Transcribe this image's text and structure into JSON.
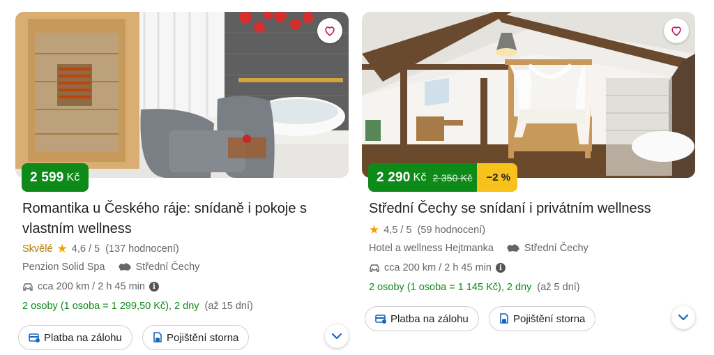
{
  "cards": [
    {
      "price": "2 599",
      "currency": "Kč",
      "title": "Romantika u Českého ráje: snídaně i pokoje s vlastním wellness",
      "rating_word": "Skvělé",
      "rating": "4,6 / 5",
      "reviews": "(137 hodnocení)",
      "hotel": "Penzion Solid Spa",
      "region": "Střední Čechy",
      "distance": "cca 200 km / 2 h 45 min",
      "offer": "2 osoby (1 osoba = 1 299,50 Kč), 2 dny",
      "availability": "(až 15 dní)",
      "pay_label": "Platba na zálohu",
      "insurance_label": "Pojištění storna"
    },
    {
      "price": "2 290",
      "currency": "Kč",
      "old_price": "2 350 Kč",
      "discount": "−2 %",
      "title": "Střední Čechy se snídaní i privátním wellness",
      "rating": "4,5 / 5",
      "reviews": "(59 hodnocení)",
      "hotel": "Hotel a wellness Hejtmanka",
      "region": "Střední Čechy",
      "distance": "cca 200 km / 2 h 45 min",
      "offer": "2 osoby (1 osoba = 1 145 Kč), 2 dny",
      "availability": "(až 5 dní)",
      "pay_label": "Platba na zálohu",
      "insurance_label": "Pojištění storna"
    }
  ],
  "colors": {
    "price_bg": "#0e8a19",
    "discount_bg": "#f7c21b",
    "offer_text": "#0e8a19",
    "rating_word": "#b07a00",
    "star": "#f2a000",
    "chevron": "#1565c0"
  }
}
